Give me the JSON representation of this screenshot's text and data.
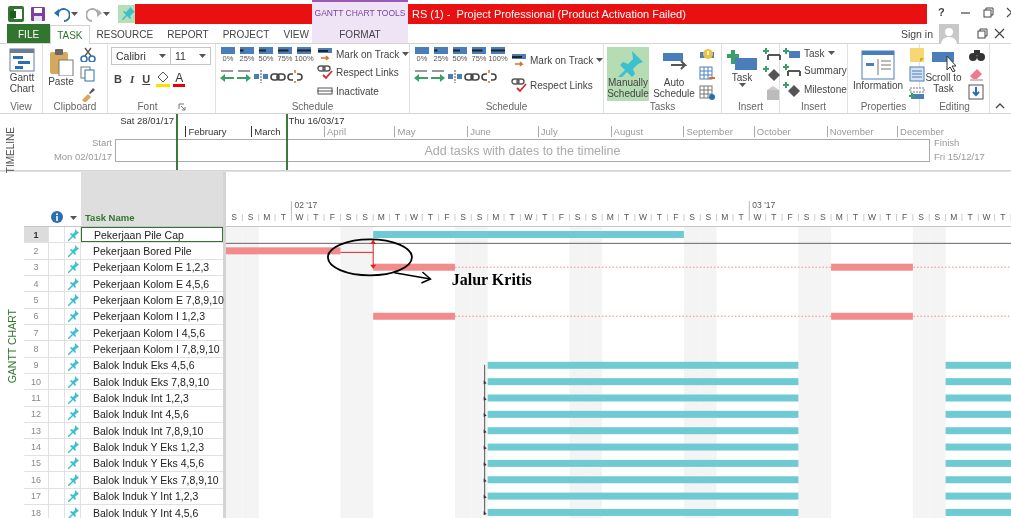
{
  "title_bar": {
    "contextual_group": "GANTT CHART TOOLS",
    "title": "RS (1) -  Project Professional (Product Activation Failed)",
    "help": "?"
  },
  "tabs": [
    {
      "label": "FILE",
      "kind": "file",
      "selected": false
    },
    {
      "label": "TASK",
      "kind": "tab",
      "selected": true
    },
    {
      "label": "RESOURCE",
      "kind": "tab",
      "selected": false
    },
    {
      "label": "REPORT",
      "kind": "tab",
      "selected": false
    },
    {
      "label": "PROJECT",
      "kind": "tab",
      "selected": false
    },
    {
      "label": "VIEW",
      "kind": "tab",
      "selected": false
    },
    {
      "label": "FORMAT",
      "kind": "contextual",
      "selected": false
    }
  ],
  "account": {
    "label": "Sign in"
  },
  "ribbon": {
    "view": {
      "label": "View",
      "gantt_chart": "Gantt Chart"
    },
    "clipboard": {
      "label": "Clipboard",
      "paste": "Paste"
    },
    "font": {
      "label": "Font",
      "family": "Calibri",
      "size": "11",
      "bold": "B",
      "italic": "I",
      "underline": "U",
      "color_letter": "A"
    },
    "schedule": {
      "label": "Schedule",
      "percent": [
        "0%",
        "25%",
        "50%",
        "75%",
        "100%"
      ],
      "mark_on_track": "Mark on Track",
      "respect_links": "Respect Links",
      "inactivate": "Inactivate"
    },
    "schedule_2": {
      "label": "Schedule",
      "percent": [
        "0%",
        "25%",
        "50%",
        "75%",
        "100%"
      ],
      "mark_on_track": "Mark on Track",
      "respect_links": "Respect Links"
    },
    "tasks": {
      "label": "Tasks",
      "modes": [
        {
          "label": "Manually Schedule",
          "selected": true
        },
        {
          "label": "Auto Schedule",
          "selected": false
        }
      ]
    },
    "insert": {
      "label": "Insert",
      "task": "Task"
    },
    "insert_2": {
      "label": "Insert",
      "task": "Task",
      "summary": "Summary",
      "milestone": "Milestone"
    },
    "properties": {
      "label": "Properties",
      "information": "Information"
    },
    "editing": {
      "label": "Editing",
      "scroll_to_task": "Scroll to Task"
    }
  },
  "timeline": {
    "label": "TIMELINE",
    "range_start": "Sat 28/01/17",
    "range_end": "Thu 16/03/17",
    "start_label": "Start",
    "start_date": "Mon 02/01/17",
    "finish_label": "Finish",
    "finish_date": "Fri 15/12/17",
    "placeholder": "Add tasks with dates to the timeline",
    "months": [
      {
        "label": "February",
        "in_range": true
      },
      {
        "label": "March",
        "in_range": true
      },
      {
        "label": "April",
        "in_range": false
      },
      {
        "label": "May",
        "in_range": false
      },
      {
        "label": "June",
        "in_range": false
      },
      {
        "label": "July",
        "in_range": false
      },
      {
        "label": "August",
        "in_range": false
      },
      {
        "label": "September",
        "in_range": false
      },
      {
        "label": "October",
        "in_range": false
      },
      {
        "label": "November",
        "in_range": false
      },
      {
        "label": "December",
        "in_range": false
      }
    ]
  },
  "gantt": {
    "view_label": "GANTT CHART",
    "task_name_header": "Task Name",
    "timescale": {
      "months": [
        {
          "label": "02 '17"
        },
        {
          "label": "03 '17"
        }
      ],
      "days": [
        "S",
        "S",
        "M",
        "T",
        "W",
        "T",
        "F",
        "S",
        "S",
        "M",
        "T",
        "W",
        "T",
        "F",
        "S",
        "S",
        "M",
        "T",
        "W",
        "T",
        "F",
        "S",
        "S",
        "M",
        "T",
        "W",
        "T",
        "F",
        "S",
        "S",
        "M",
        "T",
        "W",
        "T",
        "F",
        "S",
        "S",
        "M",
        "T",
        "W",
        "T",
        "F",
        "S",
        "S",
        "M",
        "T",
        "W",
        "T"
      ]
    },
    "annotation": {
      "text": "Jalur Kritis"
    },
    "rows": [
      {
        "id": "1",
        "name": "Pekerjaan Pile Cap",
        "selected": true
      },
      {
        "id": "2",
        "name": "Pekerjaan Bored Pile",
        "selected": false
      },
      {
        "id": "3",
        "name": "Pekerjaan Kolom E 1,2,3",
        "selected": false
      },
      {
        "id": "4",
        "name": "Pekerjaan Kolom E 4,5,6",
        "selected": false
      },
      {
        "id": "5",
        "name": "Pekerjaan Kolom E 7,8,9,10",
        "selected": false
      },
      {
        "id": "6",
        "name": "Pekerjaan Kolom I 1,2,3",
        "selected": false
      },
      {
        "id": "7",
        "name": "Pekerjaan Kolom I 4,5,6",
        "selected": false
      },
      {
        "id": "8",
        "name": "Pekerjaan Kolom I 7,8,9,10",
        "selected": false
      },
      {
        "id": "9",
        "name": "Balok Induk Eks 4,5,6",
        "selected": false
      },
      {
        "id": "10",
        "name": "Balok Induk Eks 7,8,9,10",
        "selected": false
      },
      {
        "id": "11",
        "name": "Balok Induk Int 1,2,3",
        "selected": false
      },
      {
        "id": "12",
        "name": "Balok Induk Int 4,5,6",
        "selected": false
      },
      {
        "id": "13",
        "name": "Balok Induk Int 7,8,9,10",
        "selected": false
      },
      {
        "id": "14",
        "name": "Balok Induk Y Eks 1,2,3",
        "selected": false
      },
      {
        "id": "15",
        "name": "Balok Induk Y Eks 4,5,6",
        "selected": false
      },
      {
        "id": "16",
        "name": "Balok Induk Y Eks 7,8,9,10",
        "selected": false
      },
      {
        "id": "17",
        "name": "Balok Induk Y Int 1,2,3",
        "selected": false
      },
      {
        "id": "18",
        "name": "Balok Induk Y Int 4,5,6",
        "selected": false
      }
    ]
  }
}
